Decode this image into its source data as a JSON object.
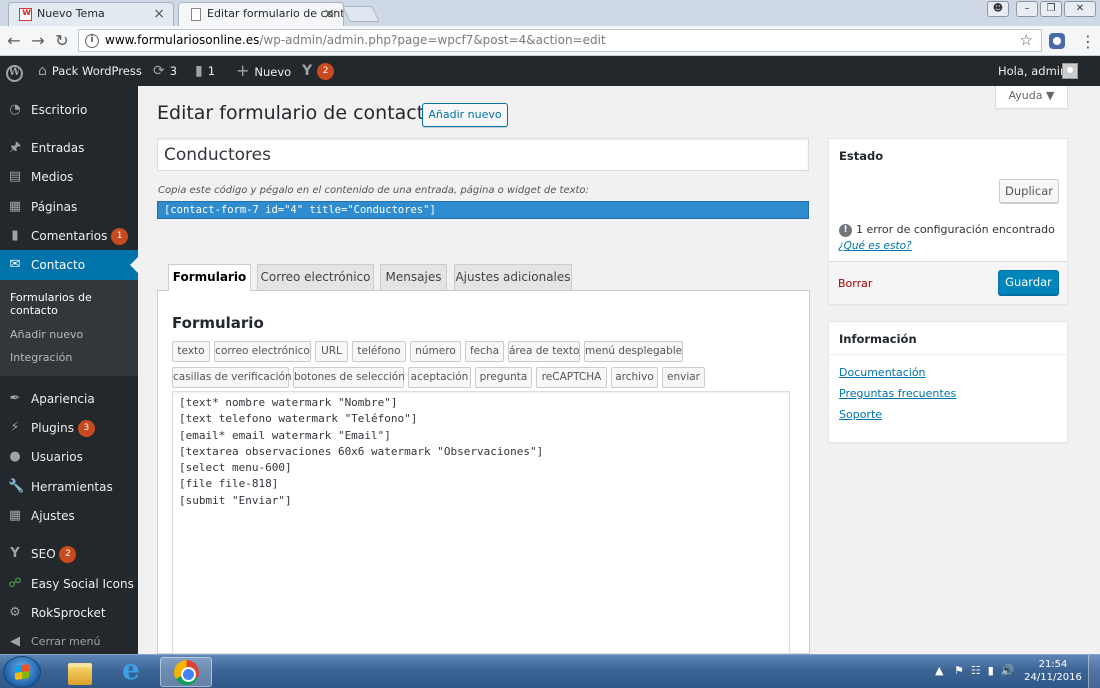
{
  "browser": {
    "tabs": [
      {
        "title": "Nuevo Tema",
        "close": "×"
      },
      {
        "title": "Editar formulario de cont",
        "close": "×"
      }
    ],
    "url_domain": "www.formulariosonline.es",
    "url_path": "/wp-admin/admin.php?page=wpcf7&post=4&action=edit"
  },
  "adminbar": {
    "site_name": "Pack WordPress",
    "updates_count": "3",
    "comments_count": "1",
    "new_label": "Nuevo",
    "seo_count": "2",
    "greeting": "Hola, admin"
  },
  "sidebar": {
    "items": [
      {
        "label": "Escritorio",
        "icon": "dashboard-icon"
      },
      {
        "label": "Entradas",
        "icon": "pin-icon"
      },
      {
        "label": "Medios",
        "icon": "media-icon"
      },
      {
        "label": "Páginas",
        "icon": "pages-icon"
      },
      {
        "label": "Comentarios",
        "icon": "comments-icon",
        "badge": "1"
      },
      {
        "label": "Contacto",
        "icon": "mail-icon"
      },
      {
        "label": "Apariencia",
        "icon": "brush-icon"
      },
      {
        "label": "Plugins",
        "icon": "plugin-icon",
        "badge": "3"
      },
      {
        "label": "Usuarios",
        "icon": "users-icon"
      },
      {
        "label": "Herramientas",
        "icon": "tools-icon"
      },
      {
        "label": "Ajustes",
        "icon": "settings-icon"
      },
      {
        "label": "SEO",
        "icon": "yoast-icon",
        "badge": "2"
      },
      {
        "label": "Easy Social Icons",
        "icon": "share-icon"
      },
      {
        "label": "RokSprocket",
        "icon": "sprocket-icon"
      },
      {
        "label": "Cerrar menú",
        "icon": "collapse-icon"
      }
    ],
    "submenu": [
      "Formularios de contacto",
      "Añadir nuevo",
      "Integración"
    ]
  },
  "page": {
    "title": "Editar formulario de contacto",
    "add_new": "Añadir nuevo",
    "help": "Ayuda ▼",
    "form_title": "Conductores",
    "shortcode_hint": "Copia este código y pégalo en el contenido de una entrada, página o widget de texto:",
    "shortcode": "[contact-form-7 id=\"4\" title=\"Conductores\"]"
  },
  "tabs": [
    "Formulario",
    "Correo electrónico",
    "Mensajes",
    "Ajustes adicionales"
  ],
  "panel": {
    "heading": "Formulario",
    "tag_buttons_row1": [
      "texto",
      "correo electrónico",
      "URL",
      "teléfono",
      "número",
      "fecha",
      "área de texto",
      "menú desplegable"
    ],
    "tag_buttons_row2": [
      "casillas de verificación",
      "botones de selección",
      "aceptación",
      "pregunta",
      "reCAPTCHA",
      "archivo",
      "enviar"
    ],
    "code_lines": [
      "[text* nombre watermark \"Nombre\"]",
      "[text telefono watermark \"Teléfono\"]",
      "[email* email watermark \"Email\"]",
      "[textarea observaciones 60x6 watermark \"Observaciones\"]",
      "[select menu-600]",
      "[file file-818]",
      "[submit \"Enviar\"]"
    ]
  },
  "status_box": {
    "title": "Estado",
    "duplicate": "Duplicar",
    "error_text": "1 error de configuración encontrado",
    "whats_this": "¿Qué es esto?",
    "delete": "Borrar",
    "save": "Guardar"
  },
  "info_box": {
    "title": "Información",
    "links": [
      "Documentación",
      "Preguntas frecuentes",
      "Soporte"
    ]
  },
  "taskbar": {
    "time": "21:54",
    "date": "24/11/2016"
  },
  "colors": {
    "wp_blue": "#0073aa",
    "admin_dark": "#23282d",
    "bubble": "#ca4a1f",
    "shortcode_bg": "#2e8ccf"
  }
}
